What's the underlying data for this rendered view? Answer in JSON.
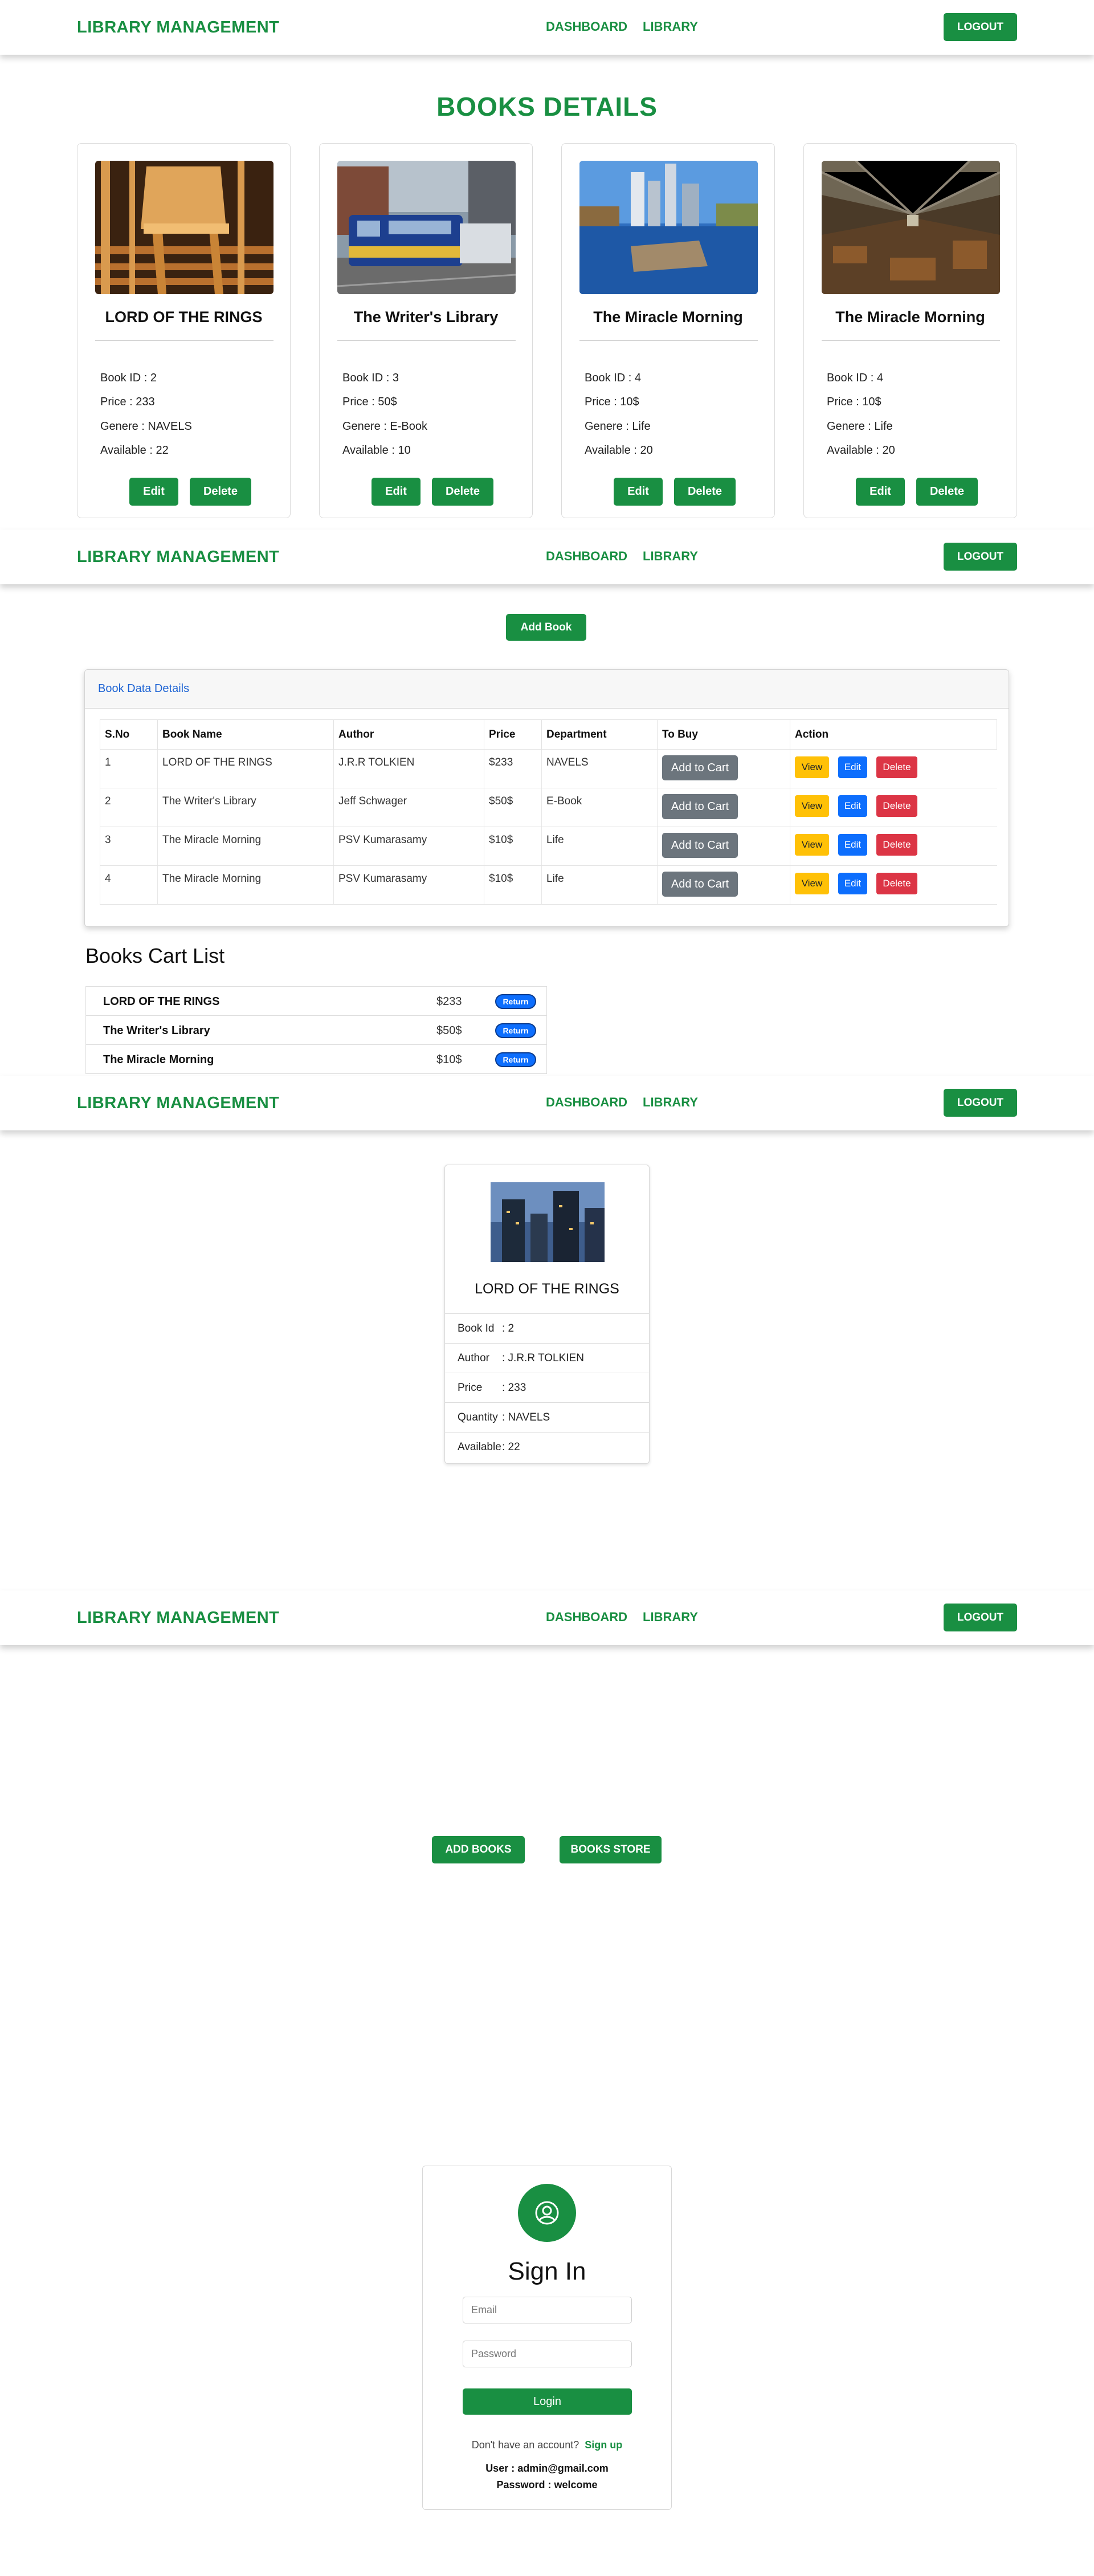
{
  "navbar": {
    "brand": "LIBRARY MANAGEMENT",
    "dashboard": "DASHBOARD",
    "library": "LIBRARY",
    "logout": "LOGOUT"
  },
  "books_details": {
    "title": "BOOKS DETAILS",
    "edit_label": "Edit",
    "delete_label": "Delete",
    "cards": [
      {
        "title": "LORD OF THE RINGS",
        "book_id": "Book ID : 2",
        "price": "Price : 233",
        "genre": "Genere : NAVELS",
        "available": "Available : 22",
        "image": "chairs-photo"
      },
      {
        "title": "The Writer's Library",
        "book_id": "Book ID : 3",
        "price": "Price : 50$",
        "genre": "Genere : E-Book",
        "available": "Available : 10",
        "image": "train-photo"
      },
      {
        "title": "The Miracle Morning",
        "book_id": "Book ID : 4",
        "price": "Price : 10$",
        "genre": "Genere : Life",
        "available": "Available : 20",
        "image": "city-lake-photo"
      },
      {
        "title": "The Miracle Morning",
        "book_id": "Book ID : 4",
        "price": "Price : 10$",
        "genre": "Genere : Life",
        "available": "Available : 20",
        "image": "abandoned-factory-photo"
      }
    ]
  },
  "library": {
    "add_book": "Add Book",
    "table_title": "Book Data Details",
    "columns": [
      "S.No",
      "Book Name",
      "Author",
      "Price",
      "Department",
      "To Buy",
      "Action"
    ],
    "rows": [
      {
        "sno": "1",
        "name": "LORD OF THE RINGS",
        "author": "J.R.R TOLKIEN",
        "price": "$233",
        "dept": "NAVELS"
      },
      {
        "sno": "2",
        "name": "The Writer's Library",
        "author": "Jeff Schwager",
        "price": "$50$",
        "dept": "E-Book"
      },
      {
        "sno": "3",
        "name": "The Miracle Morning",
        "author": "PSV Kumarasamy",
        "price": "$10$",
        "dept": "Life"
      },
      {
        "sno": "4",
        "name": "The Miracle Morning",
        "author": "PSV Kumarasamy",
        "price": "$10$",
        "dept": "Life"
      }
    ],
    "add_to_cart": "Add to Cart",
    "view": "View",
    "edit": "Edit",
    "delete": "Delete",
    "cart_title": "Books Cart List",
    "cart_items": [
      {
        "name": "LORD OF THE RINGS",
        "price": "$233"
      },
      {
        "name": "The Writer's Library",
        "price": "$50$"
      },
      {
        "name": "The Miracle Morning",
        "price": "$10$"
      }
    ],
    "return": "Return"
  },
  "single_book": {
    "title": "LORD OF THE RINGS",
    "rows": [
      {
        "label": "Book Id",
        "value": ":  2"
      },
      {
        "label": "Author",
        "value": ": J.R.R TOLKIEN"
      },
      {
        "label": "Price",
        "value": ": 233"
      },
      {
        "label": "Quantity",
        "value": ": NAVELS"
      },
      {
        "label": "Available",
        "value": ": 22"
      }
    ]
  },
  "dashboard": {
    "add_books": "ADD BOOKS",
    "books_store": "BOOKS STORE"
  },
  "signin": {
    "title": "Sign In",
    "email_placeholder": "Email",
    "password_placeholder": "Password",
    "login": "Login",
    "no_account": "Don't have an account?",
    "signup": "Sign up",
    "user_hint": "User : admin@gmail.com",
    "password_hint": "Password : welcome"
  },
  "colors": {
    "brand_green": "#198f42",
    "view_yellow": "#ffc107",
    "edit_blue": "#0d6efd",
    "delete_red": "#dc3545",
    "cart_gray": "#6c757d"
  }
}
